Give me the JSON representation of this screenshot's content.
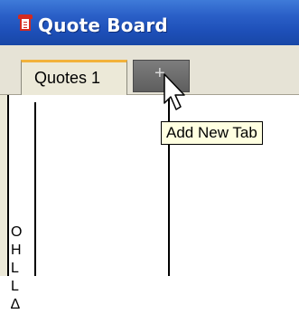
{
  "window": {
    "title": "Quote Board"
  },
  "tabs": [
    {
      "label": "Quotes 1"
    }
  ],
  "add_tab": {
    "label": "+",
    "tooltip": "Add New Tab"
  },
  "board": {
    "vertical_text": [
      "O",
      "H",
      "L",
      "L",
      "∆"
    ]
  },
  "colors": {
    "titlebar": "#2a5fc7",
    "active_tab_accent": "#f2b23b",
    "add_tab_bg": "#6e6e6e",
    "tooltip_bg": "#ffffe1"
  },
  "icons": {
    "app": "notepad-icon",
    "cursor": "mouse-pointer-icon"
  }
}
